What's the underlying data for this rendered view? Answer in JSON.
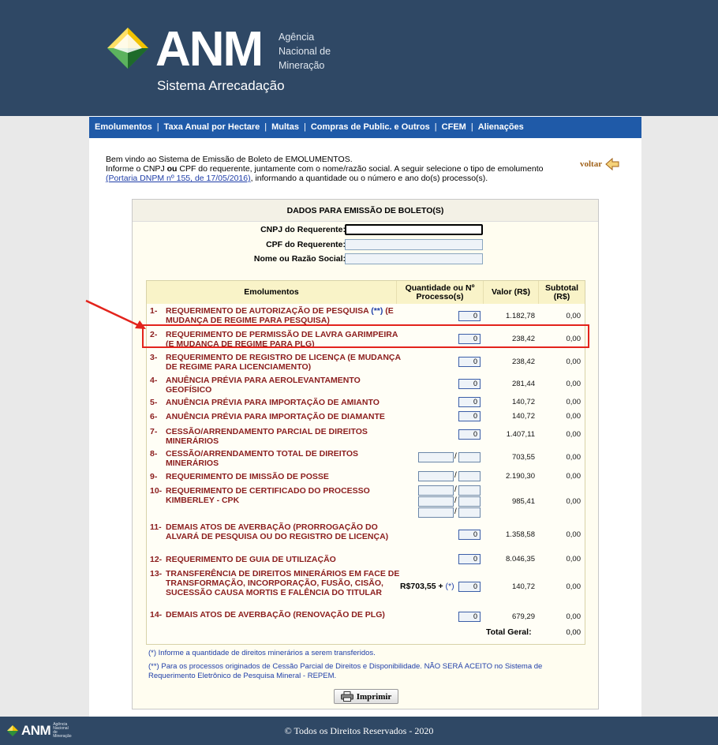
{
  "header": {
    "logo_text": "ANM",
    "tagline_line1": "Agência",
    "tagline_line2": "Nacional de",
    "tagline_line3": "Mineração",
    "system_name": "Sistema Arrecadação"
  },
  "nav": {
    "items": [
      "Emolumentos",
      "Taxa Anual por Hectare",
      "Multas",
      "Compras de Public. e Outros",
      "CFEM",
      "Alienações"
    ]
  },
  "intro": {
    "line1": "Bem vindo ao Sistema de Emissão de Boleto de EMOLUMENTOS.",
    "line2_a": "Informe o CNPJ ",
    "line2_ou": "ou",
    "line2_b": " CPF do requerente, juntamente com o nome/razão social. A seguir selecione o tipo de emolumento",
    "link": "(Portaria DNPM nº 155, de 17/05/2016)",
    "line3_b": ", informando a quantidade ou o número e ano do(s) processo(s).",
    "voltar": "voltar"
  },
  "form": {
    "title": "DADOS PARA EMISSÃO DE BOLETO(S)",
    "cnpj_label": "CNPJ do Requerente:",
    "cpf_label": "CPF do Requerente:",
    "nome_label": "Nome ou Razão Social:"
  },
  "table": {
    "col_emolumentos": "Emolumentos",
    "col_quantidade": "Quantidade ou Nº Processo(s)",
    "col_valor": "Valor (R$)",
    "col_subtotal": "Subtotal (R$)",
    "rows": [
      {
        "num": "1-",
        "desc": "REQUERIMENTO DE AUTORIZAÇÃO DE PESQUISA",
        "desc_blue": "(**)",
        "desc_tail": " (E MUDANÇA DE REGIME PARA PESQUISA)",
        "qty": "0",
        "valor": "1.182,78",
        "subtotal": "0,00"
      },
      {
        "num": "2-",
        "desc": "REQUERIMENTO DE PERMISSÃO DE LAVRA GARIMPEIRA (E MUDANÇA DE REGIME PARA PLG)",
        "qty": "0",
        "valor": "238,42",
        "subtotal": "0,00"
      },
      {
        "num": "3-",
        "desc": "REQUERIMENTO DE REGISTRO DE LICENÇA (E MUDANÇA DE REGIME PARA LICENCIAMENTO)",
        "qty": "0",
        "valor": "238,42",
        "subtotal": "0,00"
      },
      {
        "num": "4-",
        "desc": "ANUÊNCIA PRÉVIA PARA AEROLEVANTAMENTO GEOFÍSICO",
        "qty": "0",
        "valor": "281,44",
        "subtotal": "0,00"
      },
      {
        "num": "5-",
        "desc": "ANUÊNCIA PRÉVIA PARA IMPORTAÇÃO DE AMIANTO",
        "qty": "0",
        "valor": "140,72",
        "subtotal": "0,00"
      },
      {
        "num": "6-",
        "desc": "ANUÊNCIA PRÉVIA PARA IMPORTAÇÃO DE DIAMANTE",
        "qty": "0",
        "valor": "140,72",
        "subtotal": "0,00"
      },
      {
        "num": "7-",
        "desc": "CESSÃO/ARRENDAMENTO PARCIAL DE DIREITOS MINERÁRIOS",
        "qty": "0",
        "valor": "1.407,11",
        "subtotal": "0,00"
      },
      {
        "num": "8-",
        "desc": "CESSÃO/ARRENDAMENTO TOTAL DE DIREITOS MINERÁRIOS",
        "valor": "703,55",
        "subtotal": "0,00"
      },
      {
        "num": "9-",
        "desc": "REQUERIMENTO DE IMISSÃO DE POSSE",
        "valor": "2.190,30",
        "subtotal": "0,00"
      },
      {
        "num": "10-",
        "desc": "REQUERIMENTO DE CERTIFICADO DO PROCESSO KIMBERLEY - CPK",
        "valor": "985,41",
        "subtotal": "0,00"
      },
      {
        "num": "11-",
        "desc": "DEMAIS ATOS DE AVERBAÇÃO (PRORROGAÇÃO DO ALVARÁ DE PESQUISA OU DO REGISTRO DE LICENÇA)",
        "qty": "0",
        "valor": "1.358,58",
        "subtotal": "0,00"
      },
      {
        "num": "12-",
        "desc": "REQUERIMENTO DE GUIA DE UTILIZAÇÃO",
        "qty": "0",
        "valor": "8.046,35",
        "subtotal": "0,00"
      },
      {
        "num": "13-",
        "desc": "TRANSFERÊNCIA DE DIREITOS MINERÁRIOS EM FACE DE TRANSFORMAÇÃO, INCORPORAÇÃO, FUSÃO, CISÃO, SUCESSÃO CAUSA MORTIS E FALÊNCIA DO TITULAR",
        "prefix": "R$703,55 + ",
        "prefix_blue": "(*)",
        "qty": "0",
        "valor": "140,72",
        "subtotal": "0,00"
      },
      {
        "num": "14-",
        "desc": "DEMAIS ATOS DE AVERBAÇÃO (RENOVAÇÃO DE PLG)",
        "qty": "0",
        "valor": "679,29",
        "subtotal": "0,00"
      }
    ],
    "total_label": "Total Geral:",
    "total_value": "0,00"
  },
  "notes": {
    "note1": "(*) Informe a quantidade de direitos minerários a serem transferidos.",
    "note2": "(**) Para os processos originados de Cessão Parcial de Direitos e Disponibilidade. NÃO SERÁ ACEITO no Sistema de Requerimento Eletrônico de Pesquisa Mineral - REPEM."
  },
  "print_button": "Imprimir",
  "footer": {
    "logo_text": "ANM",
    "logo_sub": "Agência Nacional de Mineração",
    "copyright": "© Todos os Direitos Reservados - 2020"
  },
  "colors": {
    "header_bg": "#2f4865",
    "nav_bg": "#1f5aa8",
    "row_text": "#8b1d1d",
    "highlight": "#e3231c"
  }
}
